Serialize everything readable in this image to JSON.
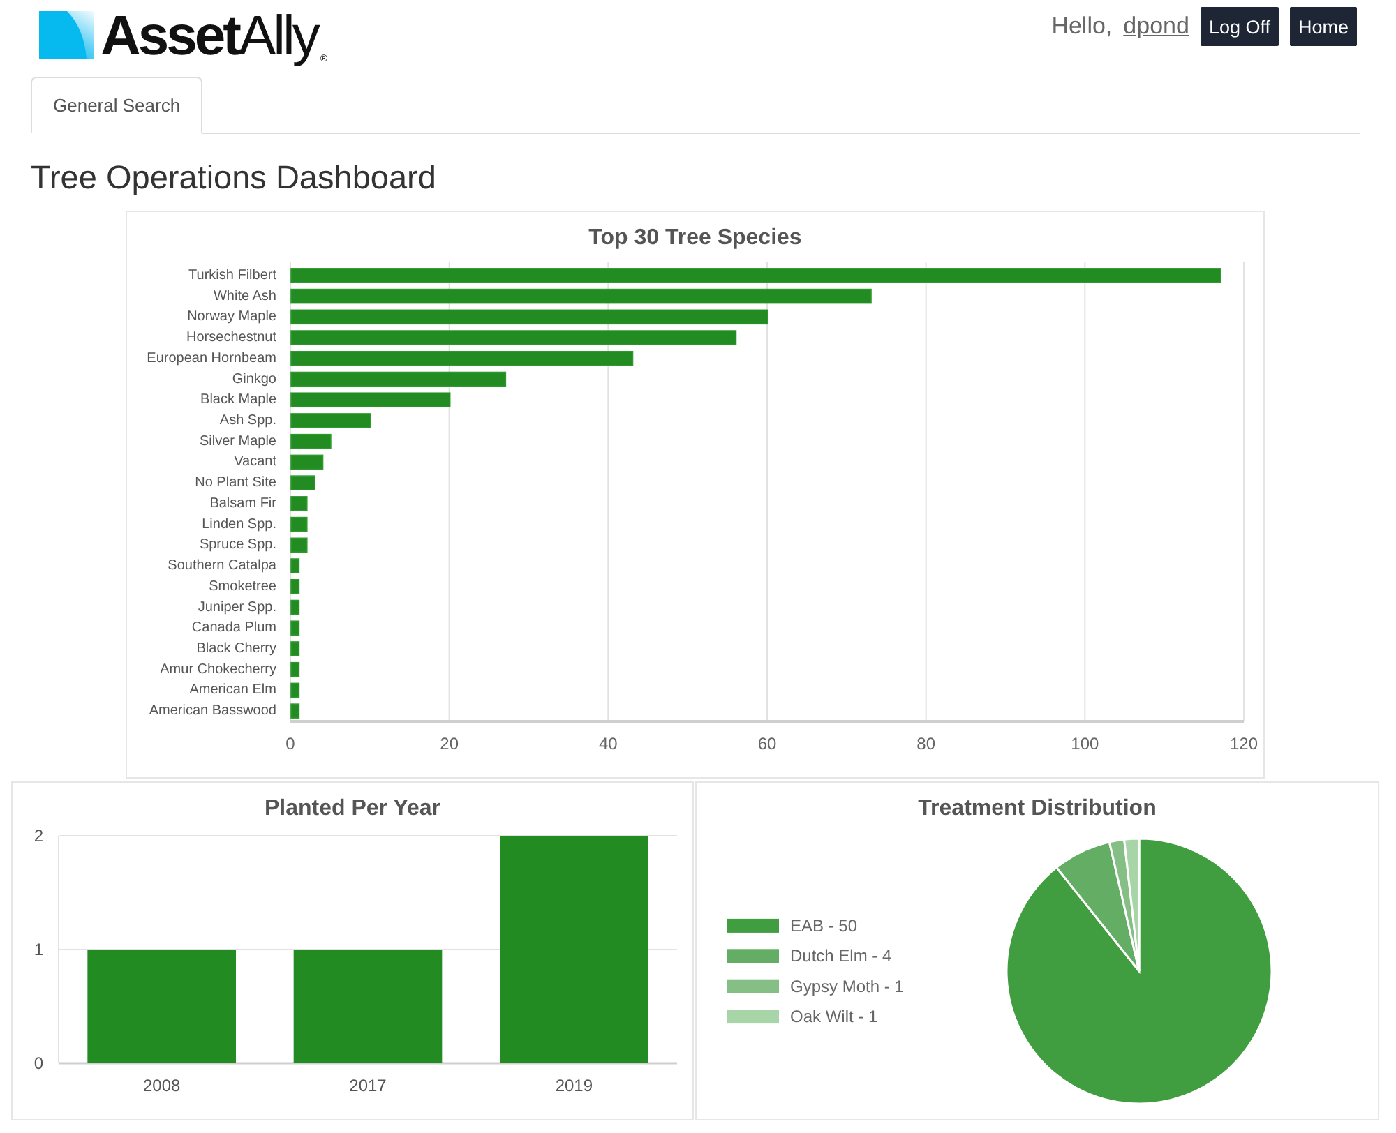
{
  "header": {
    "logo": {
      "text": "**Asset**Ally",
      "mark": "®"
    },
    "greeting": "Hello,",
    "username": "dpond",
    "buttons": [
      "Log Off",
      "Home"
    ]
  },
  "tabs": [
    {
      "label": "General Search",
      "selected": true
    }
  ],
  "page_title": "Tree Operations Dashboard",
  "species_chart": {
    "chart_data": {
      "type": "bar",
      "orientation": "horizontal",
      "title": "Top 30 Tree Species",
      "categories": [
        "Turkish Filbert",
        "White Ash",
        "Norway Maple",
        "Horsechestnut",
        "European Hornbeam",
        "Ginkgo",
        "Black Maple",
        "Ash Spp.",
        "Silver Maple",
        "Vacant",
        "No Plant Site",
        "Balsam Fir",
        "Linden Spp.",
        "Spruce Spp.",
        "Southern Catalpa",
        "Smoketree",
        "Juniper Spp.",
        "Canada Plum",
        "Black Cherry",
        "Amur Chokecherry",
        "American Elm",
        "American Basswood"
      ],
      "values": [
        117,
        73,
        60,
        56,
        43,
        27,
        20,
        10,
        5,
        4,
        3,
        2,
        2,
        2,
        1,
        1,
        1,
        1,
        1,
        1,
        1,
        1
      ],
      "xlim": [
        0,
        120
      ],
      "xticks": [
        0,
        20,
        40,
        60,
        80,
        100,
        120
      ],
      "grid": true
    }
  },
  "planted_chart": {
    "chart_data": {
      "type": "bar",
      "orientation": "vertical",
      "title": "Planted Per Year",
      "categories": [
        "2008",
        "2017",
        "2019"
      ],
      "values": [
        1,
        1,
        2
      ],
      "ylim": [
        0,
        2
      ],
      "yticks": [
        0,
        1,
        2
      ],
      "grid": true
    }
  },
  "treatment_chart": {
    "chart_data": {
      "type": "pie",
      "title": "Treatment Distribution",
      "categories": [
        "EAB - 50",
        "Dutch Elm - 4",
        "Gypsy Moth - 1",
        "Oak Wilt - 1"
      ],
      "values": [
        89.3,
        7.1,
        1.8,
        1.8
      ],
      "legend": "left"
    },
    "slices": [
      {
        "color": "#409e40"
      },
      {
        "color": "#64ad64"
      },
      {
        "color": "#85bf85"
      },
      {
        "color": "#a8d5a8"
      }
    ]
  }
}
